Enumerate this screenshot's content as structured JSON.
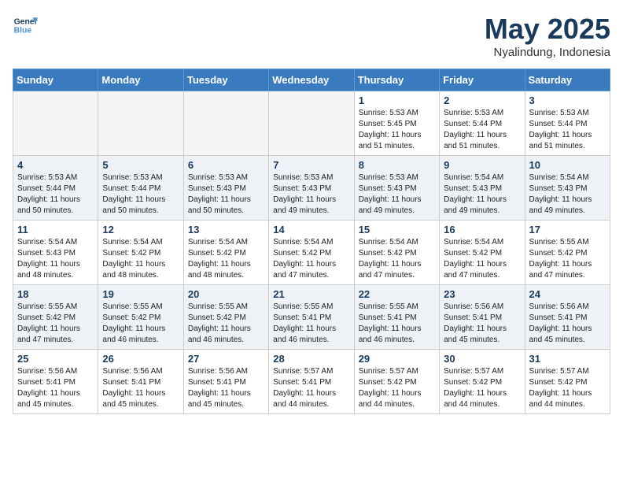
{
  "header": {
    "logo_line1": "General",
    "logo_line2": "Blue",
    "month": "May 2025",
    "location": "Nyalindung, Indonesia"
  },
  "weekdays": [
    "Sunday",
    "Monday",
    "Tuesday",
    "Wednesday",
    "Thursday",
    "Friday",
    "Saturday"
  ],
  "weeks": [
    [
      {
        "day": "",
        "info": ""
      },
      {
        "day": "",
        "info": ""
      },
      {
        "day": "",
        "info": ""
      },
      {
        "day": "",
        "info": ""
      },
      {
        "day": "1",
        "info": "Sunrise: 5:53 AM\nSunset: 5:45 PM\nDaylight: 11 hours\nand 51 minutes."
      },
      {
        "day": "2",
        "info": "Sunrise: 5:53 AM\nSunset: 5:44 PM\nDaylight: 11 hours\nand 51 minutes."
      },
      {
        "day": "3",
        "info": "Sunrise: 5:53 AM\nSunset: 5:44 PM\nDaylight: 11 hours\nand 51 minutes."
      }
    ],
    [
      {
        "day": "4",
        "info": "Sunrise: 5:53 AM\nSunset: 5:44 PM\nDaylight: 11 hours\nand 50 minutes."
      },
      {
        "day": "5",
        "info": "Sunrise: 5:53 AM\nSunset: 5:44 PM\nDaylight: 11 hours\nand 50 minutes."
      },
      {
        "day": "6",
        "info": "Sunrise: 5:53 AM\nSunset: 5:43 PM\nDaylight: 11 hours\nand 50 minutes."
      },
      {
        "day": "7",
        "info": "Sunrise: 5:53 AM\nSunset: 5:43 PM\nDaylight: 11 hours\nand 49 minutes."
      },
      {
        "day": "8",
        "info": "Sunrise: 5:53 AM\nSunset: 5:43 PM\nDaylight: 11 hours\nand 49 minutes."
      },
      {
        "day": "9",
        "info": "Sunrise: 5:54 AM\nSunset: 5:43 PM\nDaylight: 11 hours\nand 49 minutes."
      },
      {
        "day": "10",
        "info": "Sunrise: 5:54 AM\nSunset: 5:43 PM\nDaylight: 11 hours\nand 49 minutes."
      }
    ],
    [
      {
        "day": "11",
        "info": "Sunrise: 5:54 AM\nSunset: 5:43 PM\nDaylight: 11 hours\nand 48 minutes."
      },
      {
        "day": "12",
        "info": "Sunrise: 5:54 AM\nSunset: 5:42 PM\nDaylight: 11 hours\nand 48 minutes."
      },
      {
        "day": "13",
        "info": "Sunrise: 5:54 AM\nSunset: 5:42 PM\nDaylight: 11 hours\nand 48 minutes."
      },
      {
        "day": "14",
        "info": "Sunrise: 5:54 AM\nSunset: 5:42 PM\nDaylight: 11 hours\nand 47 minutes."
      },
      {
        "day": "15",
        "info": "Sunrise: 5:54 AM\nSunset: 5:42 PM\nDaylight: 11 hours\nand 47 minutes."
      },
      {
        "day": "16",
        "info": "Sunrise: 5:54 AM\nSunset: 5:42 PM\nDaylight: 11 hours\nand 47 minutes."
      },
      {
        "day": "17",
        "info": "Sunrise: 5:55 AM\nSunset: 5:42 PM\nDaylight: 11 hours\nand 47 minutes."
      }
    ],
    [
      {
        "day": "18",
        "info": "Sunrise: 5:55 AM\nSunset: 5:42 PM\nDaylight: 11 hours\nand 47 minutes."
      },
      {
        "day": "19",
        "info": "Sunrise: 5:55 AM\nSunset: 5:42 PM\nDaylight: 11 hours\nand 46 minutes."
      },
      {
        "day": "20",
        "info": "Sunrise: 5:55 AM\nSunset: 5:42 PM\nDaylight: 11 hours\nand 46 minutes."
      },
      {
        "day": "21",
        "info": "Sunrise: 5:55 AM\nSunset: 5:41 PM\nDaylight: 11 hours\nand 46 minutes."
      },
      {
        "day": "22",
        "info": "Sunrise: 5:55 AM\nSunset: 5:41 PM\nDaylight: 11 hours\nand 46 minutes."
      },
      {
        "day": "23",
        "info": "Sunrise: 5:56 AM\nSunset: 5:41 PM\nDaylight: 11 hours\nand 45 minutes."
      },
      {
        "day": "24",
        "info": "Sunrise: 5:56 AM\nSunset: 5:41 PM\nDaylight: 11 hours\nand 45 minutes."
      }
    ],
    [
      {
        "day": "25",
        "info": "Sunrise: 5:56 AM\nSunset: 5:41 PM\nDaylight: 11 hours\nand 45 minutes."
      },
      {
        "day": "26",
        "info": "Sunrise: 5:56 AM\nSunset: 5:41 PM\nDaylight: 11 hours\nand 45 minutes."
      },
      {
        "day": "27",
        "info": "Sunrise: 5:56 AM\nSunset: 5:41 PM\nDaylight: 11 hours\nand 45 minutes."
      },
      {
        "day": "28",
        "info": "Sunrise: 5:57 AM\nSunset: 5:41 PM\nDaylight: 11 hours\nand 44 minutes."
      },
      {
        "day": "29",
        "info": "Sunrise: 5:57 AM\nSunset: 5:42 PM\nDaylight: 11 hours\nand 44 minutes."
      },
      {
        "day": "30",
        "info": "Sunrise: 5:57 AM\nSunset: 5:42 PM\nDaylight: 11 hours\nand 44 minutes."
      },
      {
        "day": "31",
        "info": "Sunrise: 5:57 AM\nSunset: 5:42 PM\nDaylight: 11 hours\nand 44 minutes."
      }
    ]
  ]
}
